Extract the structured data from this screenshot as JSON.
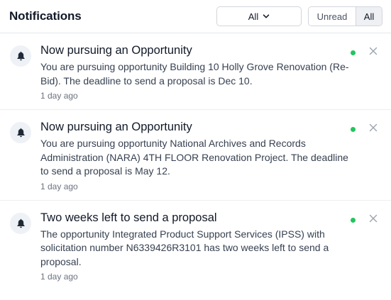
{
  "header": {
    "title": "Notifications",
    "filter_value": "All",
    "segment_unread": "Unread",
    "segment_all": "All"
  },
  "colors": {
    "unread_dot": "#22c55e"
  },
  "notifications": [
    {
      "title": "Now pursuing an Opportunity",
      "body": "You are pursuing opportunity Building 10 Holly Grove Renovation (Re-Bid). The deadline to send a proposal is Dec 10.",
      "time": "1 day ago",
      "icon": "bell-icon",
      "unread": true
    },
    {
      "title": "Now pursuing an Opportunity",
      "body": "You are pursuing opportunity National Archives and Records Administration (NARA) 4TH FLOOR Renovation Project. The deadline to send a proposal is May 12.",
      "time": "1 day ago",
      "icon": "bell-icon",
      "unread": true
    },
    {
      "title": "Two weeks left to send a proposal",
      "body": "The opportunity Integrated Product Support Services (IPSS) with solicitation number N6339426R3101 has two weeks left to send a proposal.",
      "time": "1 day ago",
      "icon": "bell-icon",
      "unread": true
    }
  ]
}
